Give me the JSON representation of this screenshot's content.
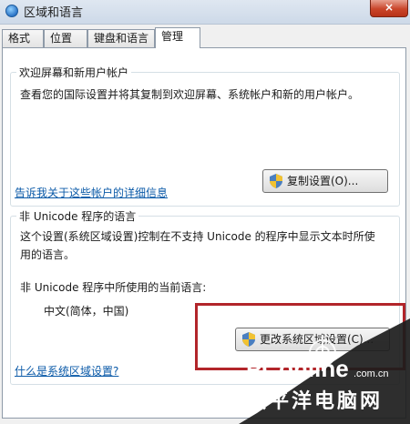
{
  "window": {
    "title": "区域和语言",
    "close_label": "×"
  },
  "tabs": [
    {
      "label": "格式",
      "active": false
    },
    {
      "label": "位置",
      "active": false
    },
    {
      "label": "键盘和语言",
      "active": false
    },
    {
      "label": "管理",
      "active": true
    }
  ],
  "welcome_group": {
    "legend": "欢迎屏幕和新用户帐户",
    "description": "查看您的国际设置并将其复制到欢迎屏幕、系统帐户和新的用户帐户。",
    "copy_button": "复制设置(O)...",
    "link": "告诉我关于这些帐户的详细信息"
  },
  "non_unicode_group": {
    "legend": "非 Unicode 程序的语言",
    "description_line1": "这个设置(系统区域设置)控制在不支持 Unicode 的程序中显示文本时所使",
    "description_line2": "用的语言。",
    "current_label": "非 Unicode 程序中所使用的当前语言:",
    "current_value": "中文(简体，中国)",
    "change_button": "更改系统区域设置(C)...",
    "link": "什么是系统区域设置?"
  },
  "watermark": {
    "brand": "PConline",
    "domain": ".com.cn",
    "chinese": "太平洋电脑网"
  },
  "colors": {
    "link": "#0b5aa8",
    "highlight_box": "#b2252a",
    "close_button": "#c9452a"
  }
}
